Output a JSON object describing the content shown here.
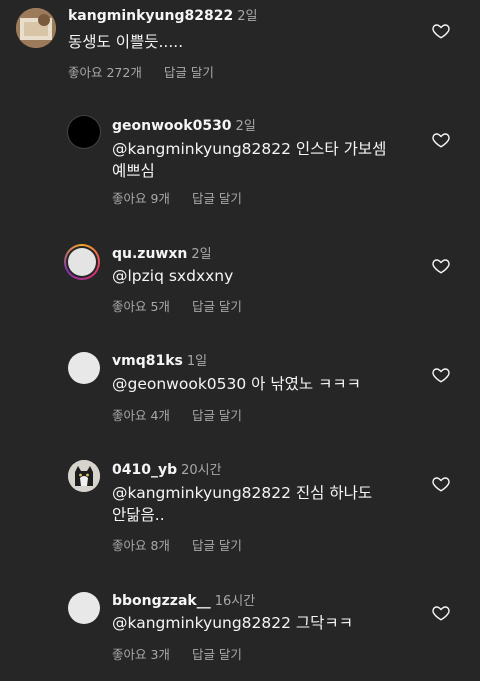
{
  "comments": [
    {
      "username": "kangminkyung82822",
      "time": "2일",
      "text": "동생도 이쁠듯.....",
      "likes": "좋아요 272개",
      "reply": "답글 달기"
    },
    {
      "username": "geonwook0530",
      "time": "2일",
      "line1": "@kangminkyung82822 인스타 가보셈",
      "line2": "예쁘심",
      "likes": "좋아요 9개",
      "reply": "답글 달기"
    },
    {
      "username": "qu.zuwxn",
      "time": "2일",
      "text": "@lpziq sxdxxny",
      "likes": "좋아요 5개",
      "reply": "답글 달기"
    },
    {
      "username": "vmq81ks",
      "time": "1일",
      "text": "@geonwook0530 아 낚였노 ㅋㅋㅋ",
      "likes": "좋아요 4개",
      "reply": "답글 달기"
    },
    {
      "username": "0410_yb",
      "time": "20시간",
      "line1": "@kangminkyung82822 진심 하나도",
      "line2": "안닮음..",
      "likes": "좋아요 8개",
      "reply": "답글 달기"
    },
    {
      "username": "bbongzzak__",
      "time": "16시간",
      "text": "@kangminkyung82822 그닥ㅋㅋ",
      "likes": "좋아요 3개",
      "reply": "답글 달기"
    }
  ],
  "colors": {
    "background": "#262626",
    "text": "#f5f5f5",
    "secondary": "#a8a8a8"
  },
  "icons": {
    "like": "heart-outline-icon"
  }
}
